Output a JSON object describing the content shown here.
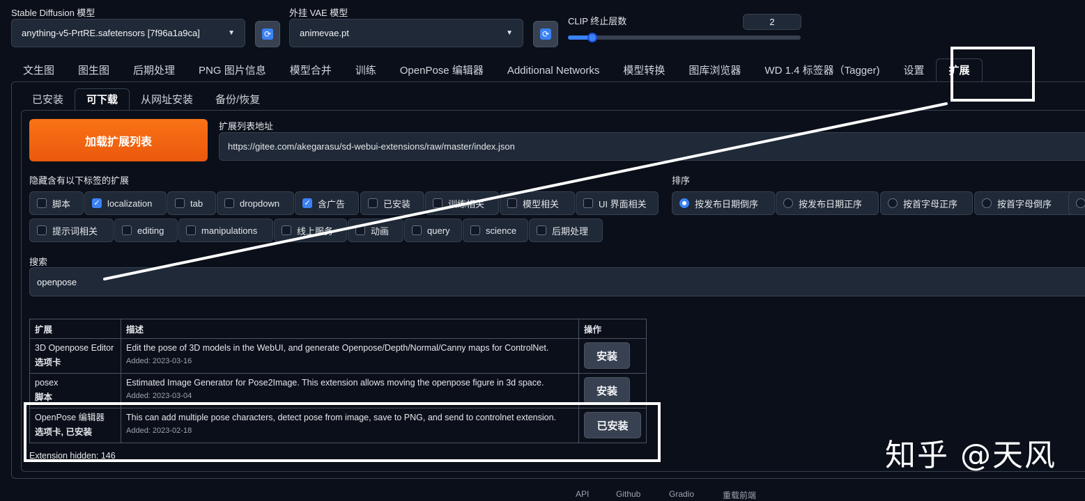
{
  "top": {
    "sd_model_label": "Stable Diffusion 模型",
    "sd_model_value": "anything-v5-PrtRE.safetensors [7f96a1a9ca]",
    "vae_label": "外挂 VAE 模型",
    "vae_value": "animevae.pt",
    "clip_label": "CLIP 终止层数",
    "clip_value": "2",
    "refresh_icon": "refresh-icon",
    "clip_slider_level": 0.08
  },
  "main_tabs": [
    "文生图",
    "图生图",
    "后期处理",
    "PNG 图片信息",
    "模型合并",
    "训练",
    "OpenPose 编辑器",
    "Additional Networks",
    "模型转换",
    "图库浏览器",
    "WD 1.4 标签器（Tagger)",
    "设置",
    "扩展"
  ],
  "sub_tabs": [
    "已安装",
    "可下载",
    "从网址安装",
    "备份/恢复"
  ],
  "load_button": "加载扩展列表",
  "url": {
    "label": "扩展列表地址",
    "value": "https://gitee.com/akegarasu/sd-webui-extensions/raw/master/index.json"
  },
  "hide_tags": {
    "label": "隐藏含有以下标签的扩展",
    "row1": [
      {
        "text": "脚本",
        "checked": false
      },
      {
        "text": "localization",
        "checked": true
      },
      {
        "text": "tab",
        "checked": false
      },
      {
        "text": "dropdown",
        "checked": false
      },
      {
        "text": "含广告",
        "checked": true
      },
      {
        "text": "已安装",
        "checked": false
      },
      {
        "text": "训练相关",
        "checked": false
      },
      {
        "text": "模型相关",
        "checked": false
      },
      {
        "text": "UI 界面相关",
        "checked": false
      }
    ],
    "row2": [
      {
        "text": "提示词相关",
        "checked": false
      },
      {
        "text": "editing",
        "checked": false
      },
      {
        "text": "manipulations",
        "checked": false
      },
      {
        "text": "线上服务",
        "checked": false
      },
      {
        "text": "动画",
        "checked": false
      },
      {
        "text": "query",
        "checked": false
      },
      {
        "text": "science",
        "checked": false
      },
      {
        "text": "后期处理",
        "checked": false
      }
    ]
  },
  "sort": {
    "label": "排序",
    "options": [
      {
        "text": "按发布日期倒序",
        "selected": true
      },
      {
        "text": "按发布日期正序",
        "selected": false
      },
      {
        "text": "按首字母正序",
        "selected": false
      },
      {
        "text": "按首字母倒序",
        "selected": false
      }
    ]
  },
  "search": {
    "label": "搜索",
    "value": "openpose"
  },
  "table": {
    "headers": [
      "扩展",
      "描述",
      "操作"
    ],
    "rows": [
      {
        "name": "3D Openpose Editor",
        "tag": "选项卡",
        "desc": "Edit the pose of 3D models in the WebUI, and generate Openpose/Depth/Normal/Canny maps for ControlNet.",
        "added": "Added: 2023-03-16",
        "action": "安装"
      },
      {
        "name": "posex",
        "tag": "脚本",
        "desc": "Estimated Image Generator for Pose2Image. This extension allows moving the openpose figure in 3d space.",
        "added": "Added: 2023-03-04",
        "action": "安装"
      },
      {
        "name": "OpenPose 编辑器",
        "tag": "选项卡, 已安装",
        "desc": "This can add multiple pose characters, detect pose from image, save to PNG, and send to controlnet extension.",
        "added": "Added: 2023-02-18",
        "action": "已安装"
      }
    ],
    "hidden_note": "Extension hidden: 146"
  },
  "watermark": "知乎 @天风",
  "footer": [
    "API",
    "Github",
    "Gradio",
    "重载前端"
  ]
}
